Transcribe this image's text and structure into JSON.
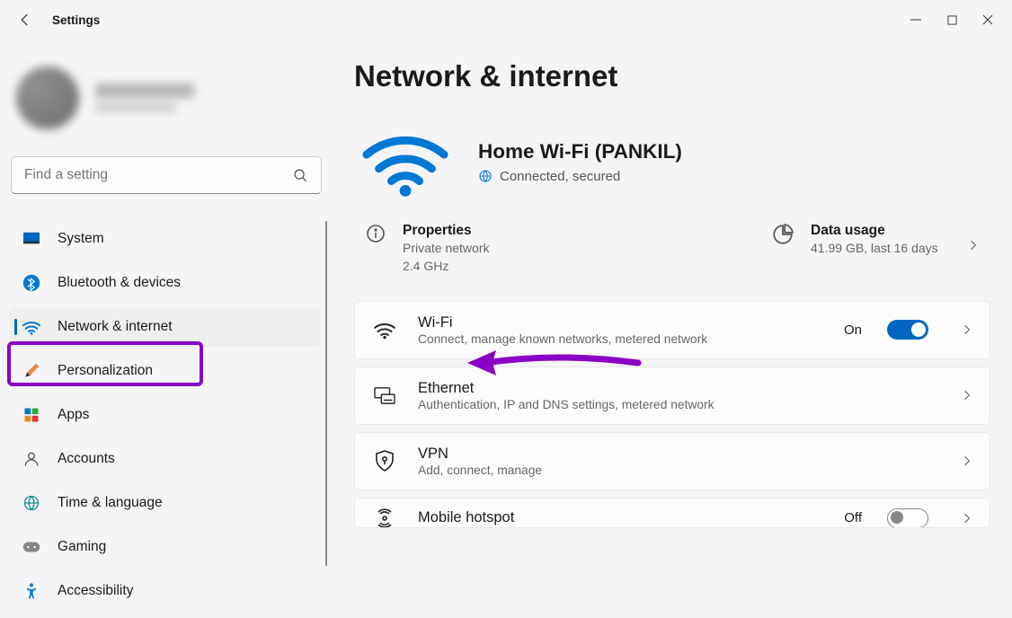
{
  "window": {
    "title": "Settings"
  },
  "search": {
    "placeholder": "Find a setting"
  },
  "sidebar": {
    "items": [
      {
        "label": "System"
      },
      {
        "label": "Bluetooth & devices"
      },
      {
        "label": "Network & internet"
      },
      {
        "label": "Personalization"
      },
      {
        "label": "Apps"
      },
      {
        "label": "Accounts"
      },
      {
        "label": "Time & language"
      },
      {
        "label": "Gaming"
      },
      {
        "label": "Accessibility"
      }
    ]
  },
  "page": {
    "title": "Network & internet",
    "connection": {
      "name": "Home Wi-Fi (PANKIL)",
      "status": "Connected, secured"
    },
    "properties": {
      "label": "Properties",
      "nettype": "Private network",
      "band": "2.4 GHz"
    },
    "data_usage": {
      "label": "Data usage",
      "detail": "41.99 GB, last 16 days"
    },
    "cards": {
      "wifi": {
        "title": "Wi-Fi",
        "sub": "Connect, manage known networks, metered network",
        "state_label": "On"
      },
      "ethernet": {
        "title": "Ethernet",
        "sub": "Authentication, IP and DNS settings, metered network"
      },
      "vpn": {
        "title": "VPN",
        "sub": "Add, connect, manage"
      },
      "hotspot": {
        "title": "Mobile hotspot",
        "state_label": "Off"
      }
    }
  }
}
